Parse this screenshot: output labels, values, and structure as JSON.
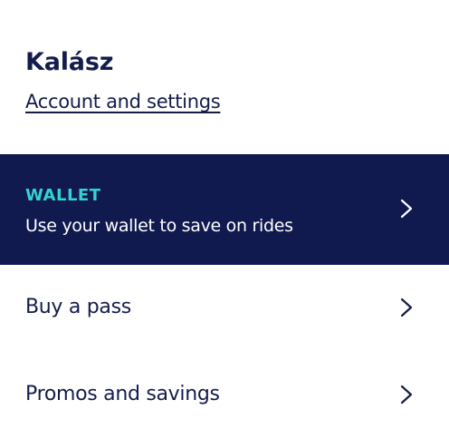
{
  "profile": {
    "name": "Kalász",
    "account_link": "Account and settings"
  },
  "wallet": {
    "title": "WALLET",
    "description": "Use your wallet to save on rides"
  },
  "menu": {
    "items": [
      {
        "label": "Buy a pass"
      },
      {
        "label": "Promos and savings"
      }
    ]
  },
  "colors": {
    "navy": "#101a4f",
    "accent": "#34d3cf",
    "text": "#141c4c"
  },
  "icons": {
    "row_chevron": "chevron-right-icon"
  }
}
